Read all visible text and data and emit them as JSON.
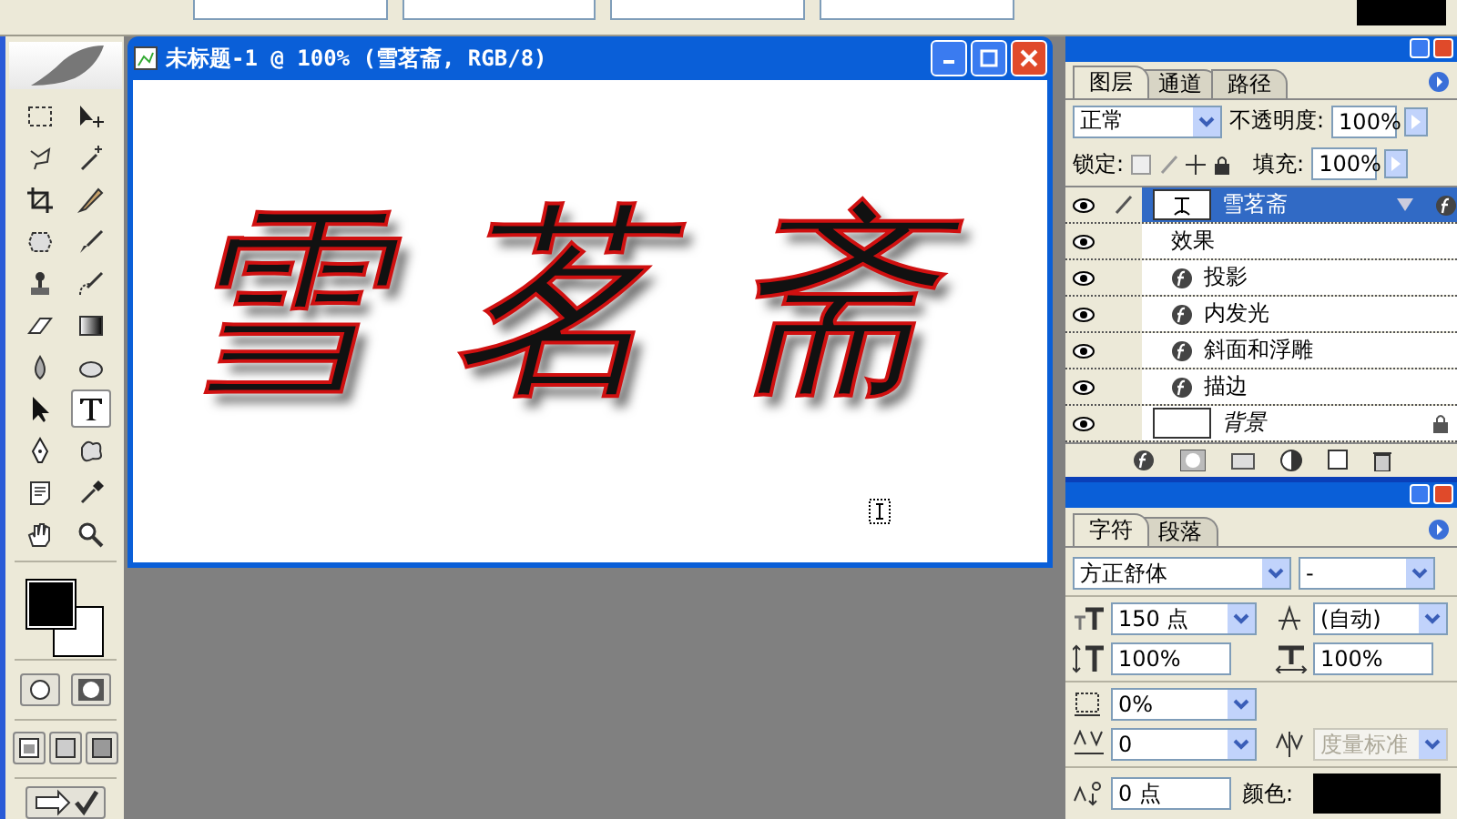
{
  "document": {
    "title": "未标题-1 @ 100% (雪茗斋, RGB/8)",
    "canvas_text": "雪茗斋"
  },
  "tools": [
    {
      "kind": "marquee",
      "selected": false
    },
    {
      "kind": "move",
      "selected": false
    },
    {
      "kind": "lasso",
      "selected": false
    },
    {
      "kind": "wand",
      "selected": false
    },
    {
      "kind": "crop",
      "selected": false
    },
    {
      "kind": "slice",
      "selected": false
    },
    {
      "kind": "patch",
      "selected": false
    },
    {
      "kind": "brush",
      "selected": false
    },
    {
      "kind": "stamp",
      "selected": false
    },
    {
      "kind": "history",
      "selected": false
    },
    {
      "kind": "eraser",
      "selected": false
    },
    {
      "kind": "gradient",
      "selected": false
    },
    {
      "kind": "drop",
      "selected": false
    },
    {
      "kind": "sponge",
      "selected": false
    },
    {
      "kind": "pointer",
      "selected": false
    },
    {
      "kind": "type",
      "selected": true
    },
    {
      "kind": "pen",
      "selected": false
    },
    {
      "kind": "shape",
      "selected": false
    },
    {
      "kind": "note",
      "selected": false
    },
    {
      "kind": "eyedropper",
      "selected": false
    },
    {
      "kind": "hand",
      "selected": false
    },
    {
      "kind": "zoom",
      "selected": false
    }
  ],
  "layers_panel": {
    "tabs": [
      {
        "label": "图层",
        "selected": true
      },
      {
        "label": "通道",
        "selected": false
      },
      {
        "label": "路径",
        "selected": false
      }
    ],
    "blend_mode": "正常",
    "opacity_label": "不透明度:",
    "opacity": "100%",
    "lock_label": "锁定:",
    "fill_label": "填充:",
    "fill": "100%",
    "layers": [
      {
        "name": "雪茗斋",
        "kind": "text",
        "selected": true,
        "visible": true,
        "locked": false,
        "effects_label": "效果",
        "effects": [
          "投影",
          "内发光",
          "斜面和浮雕",
          "描边"
        ]
      },
      {
        "name": "背景",
        "kind": "background",
        "selected": false,
        "visible": true,
        "locked": true
      }
    ]
  },
  "character_panel": {
    "tabs": [
      {
        "label": "字符",
        "selected": true
      },
      {
        "label": "段落",
        "selected": false
      }
    ],
    "font": "方正舒体",
    "style": "-",
    "size": "150 点",
    "leading": "(自动)",
    "vertical_scale": "100%",
    "horizontal_scale": "100%",
    "tsume": "0%",
    "tracking": "0",
    "kerning": "度量标准",
    "kerning_disabled": true,
    "baseline": "0 点",
    "color_label": "颜色:",
    "color": "#000000"
  }
}
